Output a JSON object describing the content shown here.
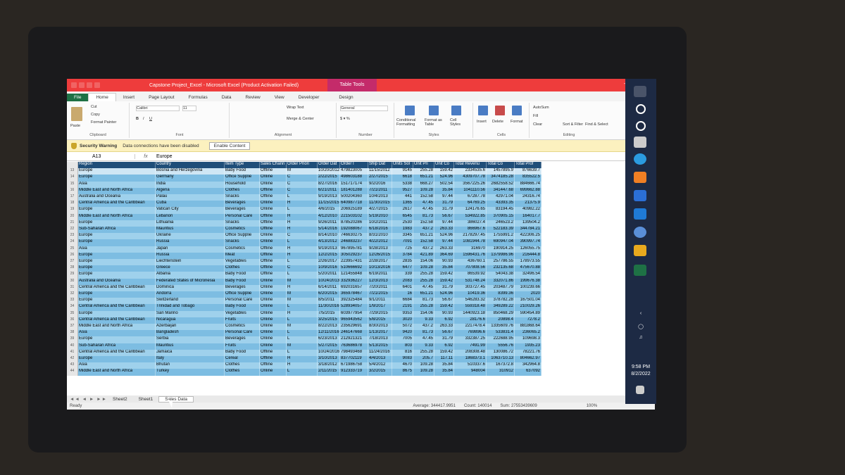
{
  "window": {
    "title": "Capstone Project_Excel - Microsoft Excel (Product Activation Failed)",
    "context_tab": "Table Tools"
  },
  "tabs": [
    "File",
    "Home",
    "Insert",
    "Page Layout",
    "Formulas",
    "Data",
    "Review",
    "View",
    "Developer",
    "Design"
  ],
  "ribbon": {
    "cut": "Cut",
    "copy": "Copy",
    "format_painter": "Format Painter",
    "paste": "Paste",
    "clipboard": "Clipboard",
    "font_name": "Calibri",
    "font_size": "11",
    "font": "Font",
    "wrap_text": "Wrap Text",
    "merge_center": "Merge & Center",
    "alignment": "Alignment",
    "number_format": "General",
    "number": "Number",
    "conditional_formatting": "Conditional Formatting",
    "format_as_table": "Format as Table",
    "cell_styles": "Cell Styles",
    "styles": "Styles",
    "insert": "Insert",
    "delete": "Delete",
    "format": "Format",
    "cells": "Cells",
    "autosum": "AutoSum",
    "fill": "Fill",
    "clear": "Clear",
    "sort_filter": "Sort & Filter",
    "find_select": "Find & Select",
    "editing": "Editing"
  },
  "security": {
    "label": "Security Warning",
    "message": "Data connections have been disabled",
    "button": "Enable Content"
  },
  "formula_bar": {
    "name_box": "A13",
    "fx": "fx",
    "value": "Europe"
  },
  "columns": [
    "Region",
    "Country",
    "Item Type",
    "Sales Chann",
    "Order Priori",
    "Order Dat",
    "Order I",
    "Ship Dat",
    "Units Sol",
    "Unit Pri",
    "Unit Co",
    "Total Revenu",
    "Total Co",
    "Total Prof"
  ],
  "rows": [
    {
      "n": "13",
      "c": [
        "Europe",
        "Bosnia and Herzegovina",
        "Baby Food",
        "Offline",
        "M",
        "10/20/2012",
        "479823005",
        "11/15/2012",
        "9145",
        "255.28",
        "159.42",
        "2334535.6",
        "1457895.9",
        "876639.7"
      ]
    },
    {
      "n": "14",
      "c": [
        "Europe",
        "Germany",
        "Office Supplie",
        "Online",
        "C",
        "2/22/2015",
        "498603188",
        "2/27/2015",
        "6618",
        "651.21",
        "524.96",
        "4309707.78",
        "3474185.28",
        "835522.5"
      ]
    },
    {
      "n": "15",
      "c": [
        "Asia",
        "India",
        "Household",
        "Online",
        "C",
        "8/27/2016",
        "151717174",
        "9/2/2016",
        "5338",
        "668.27",
        "502.54",
        "3567225.26",
        "2682558.52",
        "884666.74"
      ]
    },
    {
      "n": "16",
      "c": [
        "Middle East and North Africa",
        "Algeria",
        "Clothes",
        "Offline",
        "C",
        "6/21/2011",
        "181401288",
        "7/21/2011",
        "9527",
        "109.28",
        "35.84",
        "1041110.56",
        "341447.68",
        "699662.88"
      ]
    },
    {
      "n": "17",
      "c": [
        "Australia and Oceania",
        "Palau",
        "Snacks",
        "Offline",
        "L",
        "9/19/2013",
        "500204360",
        "10/4/2013",
        "441",
        "152.58",
        "97.44",
        "67287.78",
        "42971.04",
        "24316.74"
      ]
    },
    {
      "n": "18",
      "c": [
        "Central America and the Caribbean",
        "Cuba",
        "Beverages",
        "Online",
        "H",
        "11/15/2015",
        "640987718",
        "11/30/2015",
        "1365",
        "47.45",
        "31.79",
        "64769.25",
        "43393.35",
        "21375.9"
      ]
    },
    {
      "n": "19",
      "c": [
        "Europe",
        "Vatican City",
        "Beverages",
        "Online",
        "L",
        "4/6/2015",
        "206925189",
        "4/27/2015",
        "2617",
        "47.45",
        "31.79",
        "124176.65",
        "83194.45",
        "40982.22"
      ]
    },
    {
      "n": "20",
      "c": [
        "Middle East and North Africa",
        "Lebanon",
        "Personal Care",
        "Offline",
        "H",
        "4/12/2010",
        "221503102",
        "5/19/2010",
        "6545",
        "81.73",
        "56.67",
        "534922.85",
        "370905.15",
        "164017.7"
      ]
    },
    {
      "n": "21",
      "c": [
        "Europe",
        "Lithuania",
        "Snacks",
        "Offline",
        "H",
        "9/26/2011",
        "878520286",
        "10/2/2011",
        "2530",
        "152.58",
        "97.44",
        "386027.4",
        "246523.2",
        "139504.2"
      ]
    },
    {
      "n": "22",
      "c": [
        "Sub-Saharan Africa",
        "Mauritius",
        "Cosmetics",
        "Offline",
        "H",
        "5/14/2016",
        "192088067",
        "6/18/2016",
        "1983",
        "437.2",
        "263.33",
        "866967.6",
        "522183.39",
        "344784.21"
      ]
    },
    {
      "n": "23",
      "c": [
        "Europe",
        "Ukraine",
        "Office Supplie",
        "Online",
        "C",
        "8/14/2010",
        "746630275",
        "8/31/2010",
        "3345",
        "651.21",
        "524.96",
        "2178297.45",
        "1755991.2",
        "422306.25"
      ]
    },
    {
      "n": "24",
      "c": [
        "Europe",
        "Russia",
        "Snacks",
        "Online",
        "L",
        "4/13/2012",
        "246883237",
        "4/22/2012",
        "7091",
        "152.58",
        "97.44",
        "1081944.78",
        "690947.04",
        "390997.74"
      ]
    },
    {
      "n": "25",
      "c": [
        "Asia",
        "Japan",
        "Cosmetics",
        "Offline",
        "H",
        "9/19/2013",
        "967895781",
        "9/28/2013",
        "725",
        "437.2",
        "263.33",
        "316970",
        "190914.25",
        "126055.75"
      ]
    },
    {
      "n": "26",
      "c": [
        "Europe",
        "Russia",
        "Meat",
        "Offline",
        "H",
        "12/2/2015",
        "305029237",
        "12/26/2015",
        "3784",
        "421.89",
        "364.69",
        "1596431.76",
        "1379986.96",
        "216444.8"
      ]
    },
    {
      "n": "27",
      "c": [
        "Europe",
        "Liechtenstein",
        "Vegetables",
        "Offline",
        "L",
        "2/26/2017",
        "223957431",
        "2/28/2017",
        "2835",
        "154.06",
        "90.93",
        "436760.1",
        "257786.55",
        "178973.55"
      ]
    },
    {
      "n": "28",
      "c": [
        "Europe",
        "Greece",
        "Clothes",
        "Offline",
        "C",
        "10/9/2016",
        "510666692",
        "10/13/2016",
        "6477",
        "109.28",
        "35.84",
        "707808.56",
        "232135.68",
        "475670.88"
      ]
    },
    {
      "n": "29",
      "c": [
        "Europe",
        "Albania",
        "Baby Food",
        "Offline",
        "L",
        "5/20/2011",
        "121455848",
        "6/19/2011",
        "339",
        "255.28",
        "159.42",
        "86539.92",
        "54043.38",
        "32496.54"
      ]
    },
    {
      "n": "30",
      "c": [
        "Australia and Oceania",
        "Federated States of Micronesia",
        "Baby Food",
        "Online",
        "M",
        "10/24/2013",
        "332936227",
        "12/3/2013",
        "2083",
        "255.28",
        "159.42",
        "531748.24",
        "332071.86",
        "199676.38"
      ]
    },
    {
      "n": "31",
      "c": [
        "Central America and the Caribbean",
        "Dominica",
        "Beverages",
        "Online",
        "H",
        "6/14/2011",
        "692031657",
        "7/20/2011",
        "6401",
        "47.45",
        "31.79",
        "303727.45",
        "203487.79",
        "100239.66"
      ]
    },
    {
      "n": "32",
      "c": [
        "Europe",
        "Andorra",
        "Office Supplie",
        "Online",
        "M",
        "6/20/2015",
        "365978467",
        "7/21/2015",
        "16",
        "651.21",
        "524.96",
        "10419.36",
        "8399.36",
        "2020"
      ]
    },
    {
      "n": "33",
      "c": [
        "Europe",
        "Switzerland",
        "Personal Care",
        "Online",
        "M",
        "8/5/2011",
        "392325484",
        "9/1/2011",
        "6684",
        "81.73",
        "56.67",
        "546283.32",
        "378782.28",
        "167501.04"
      ]
    },
    {
      "n": "34",
      "c": [
        "Central America and the Caribbean",
        "Trinidad and Tobago",
        "Baby Food",
        "Online",
        "L",
        "11/30/2016",
        "528934057",
        "1/9/2017",
        "2191",
        "255.28",
        "159.42",
        "559318.48",
        "349289.22",
        "210029.26"
      ]
    },
    {
      "n": "35",
      "c": [
        "Europe",
        "San Marino",
        "Vegetables",
        "Online",
        "H",
        "7/5/2015",
        "603977954",
        "7/29/2015",
        "9353",
        "154.06",
        "90.93",
        "1440923.18",
        "850468.29",
        "590454.89"
      ]
    },
    {
      "n": "36",
      "c": [
        "Central America and the Caribbean",
        "Nicaragua",
        "Fruits",
        "Online",
        "L",
        "3/25/2015",
        "965943562",
        "5/8/2015",
        "3020",
        "9.33",
        "6.92",
        "28176.6",
        "20898.4",
        "7278.2"
      ]
    },
    {
      "n": "37",
      "c": [
        "Middle East and North Africa",
        "Azerbaijan",
        "Cosmetics",
        "Online",
        "M",
        "8/22/2013",
        "235629691",
        "8/30/2013",
        "5072",
        "437.2",
        "263.33",
        "2217478.4",
        "1335609.76",
        "881868.64"
      ]
    },
    {
      "n": "38",
      "c": [
        "Asia",
        "Bangladesh",
        "Personal Care",
        "Online",
        "L",
        "12/11/2016",
        "246147668",
        "1/13/2017",
        "9420",
        "81.73",
        "56.67",
        "769896.6",
        "533831.4",
        "236065.2"
      ]
    },
    {
      "n": "39",
      "c": [
        "Europe",
        "Serbia",
        "Beverages",
        "Online",
        "L",
        "6/23/2013",
        "212921321",
        "7/18/2013",
        "7005",
        "47.45",
        "31.79",
        "332387.25",
        "222688.95",
        "109698.3"
      ]
    },
    {
      "n": "40",
      "c": [
        "Sub-Saharan Africa",
        "Mauritius",
        "Fruits",
        "Online",
        "M",
        "5/27/2015",
        "763686978",
        "5/13/2015",
        "803",
        "9.33",
        "6.92",
        "7491.99",
        "5556.76",
        "1935.23"
      ]
    },
    {
      "n": "41",
      "c": [
        "Central America and the Caribbean",
        "Jamaica",
        "Baby Food",
        "Offline",
        "L",
        "10/24/2016",
        "798493468",
        "11/24/2016",
        "816",
        "255.28",
        "159.42",
        "208308.48",
        "130086.72",
        "78221.76"
      ]
    },
    {
      "n": "42",
      "c": [
        "Europe",
        "Italy",
        "Cereal",
        "Offline",
        "H",
        "3/10/2013",
        "837702119",
        "4/4/2013",
        "9083",
        "205.7",
        "117.11",
        "1868373.1",
        "1063710.13",
        "804662.97"
      ]
    },
    {
      "n": "43",
      "c": [
        "Asia",
        "Bhutan",
        "Clothes",
        "Offline",
        "H",
        "3/18/2012",
        "671986758",
        "5/4/2012",
        "4670",
        "109.28",
        "35.84",
        "510337.6",
        "167372.8",
        "342964.8"
      ]
    },
    {
      "n": "44",
      "c": [
        "Middle East and North Africa",
        "Turkey",
        "Clothes",
        "Online",
        "L",
        "2/11/2015",
        "912333719",
        "3/2/2015",
        "8675",
        "109.28",
        "35.84",
        "948004",
        "310912",
        "637092"
      ]
    }
  ],
  "sheet_tabs": [
    "Sheet2",
    "Sheet1",
    "Sales Data"
  ],
  "status": {
    "ready": "Ready",
    "average": "Average: 344417.9951",
    "count": "Count: 140014",
    "sum": "Sum: 27553439609",
    "zoom": "100%"
  },
  "taskbar": {
    "time": "9:58 PM",
    "date": "8/2/2022"
  },
  "colors": {
    "title": "#ee3c3c",
    "header": "#1f4e79",
    "row_light": "#9fd1ec",
    "row_dark": "#7dbde2"
  }
}
